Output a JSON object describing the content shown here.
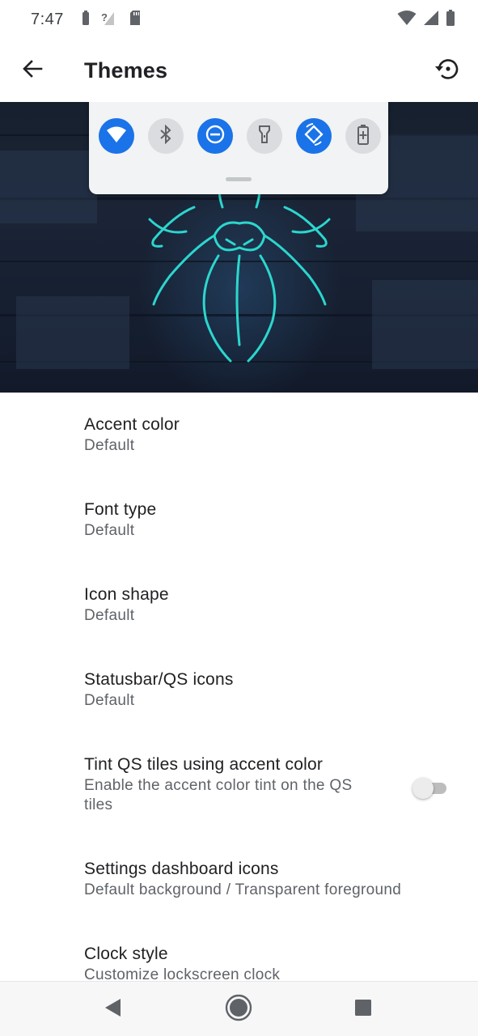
{
  "status_bar": {
    "time": "7:47",
    "left_icons": [
      "battery-saver-icon",
      "no-signal-icon",
      "sd-card-icon"
    ],
    "right_icons": [
      "wifi-icon",
      "cell-signal-icon",
      "battery-icon"
    ]
  },
  "toolbar": {
    "title": "Themes",
    "back_icon": "arrow-back-icon",
    "reset_icon": "history-icon"
  },
  "preview": {
    "qs_tiles": [
      {
        "icon": "wifi-icon",
        "state": "on"
      },
      {
        "icon": "bluetooth-icon",
        "state": "off"
      },
      {
        "icon": "do-not-disturb-icon",
        "state": "on"
      },
      {
        "icon": "flashlight-icon",
        "state": "off"
      },
      {
        "icon": "auto-rotate-icon",
        "state": "on"
      },
      {
        "icon": "battery-saver-icon",
        "state": "off"
      }
    ],
    "accent_color": "#1a73e8",
    "wallpaper_glow_color": "#2de0d6"
  },
  "settings": [
    {
      "title": "Accent color",
      "summary": "Default"
    },
    {
      "title": "Font type",
      "summary": "Default"
    },
    {
      "title": "Icon shape",
      "summary": "Default"
    },
    {
      "title": "Statusbar/QS icons",
      "summary": "Default"
    },
    {
      "title": "Tint QS tiles using accent color",
      "summary": "Enable the accent color tint on the QS tiles",
      "toggle": false
    },
    {
      "title": "Settings dashboard icons",
      "summary": "Default background / Transparent foreground"
    },
    {
      "title": "Clock style",
      "summary": "Customize lockscreen clock"
    }
  ],
  "nav_bar": {
    "buttons": [
      "back-triangle-icon",
      "home-circle-icon",
      "recents-square-icon"
    ]
  }
}
